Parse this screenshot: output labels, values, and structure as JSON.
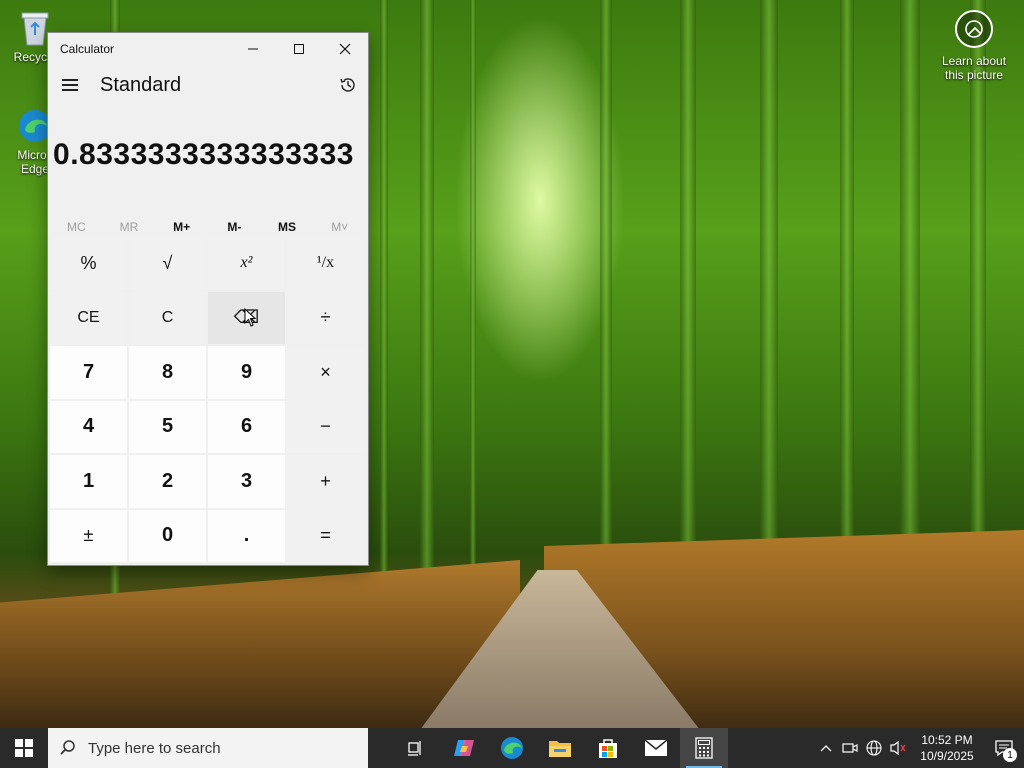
{
  "desktop": {
    "icons": [
      {
        "label": "Recycle",
        "icon": "recycle-bin-icon"
      },
      {
        "label": "Micros Edge",
        "icon": "edge-icon"
      }
    ],
    "learn_label": "Learn about this picture"
  },
  "calculator": {
    "window_title": "Calculator",
    "mode": "Standard",
    "display_value": "0.8333333333333333",
    "memory_buttons": [
      "MC",
      "MR",
      "M+",
      "M-",
      "MS",
      "M˅"
    ],
    "keys": [
      "%",
      "√",
      "x²",
      "¹/x",
      "CE",
      "C",
      "⌫",
      "÷",
      "7",
      "8",
      "9",
      "×",
      "4",
      "5",
      "6",
      "−",
      "1",
      "2",
      "3",
      "+",
      "±",
      "0",
      ".",
      "="
    ]
  },
  "taskbar": {
    "search_placeholder": "Type here to search",
    "clock_time": "10:52 PM",
    "clock_date": "10/9/2025",
    "notification_count": "1"
  },
  "colors": {
    "accent": "#76b9ed",
    "taskbar": "#2a2a2a",
    "calc_bg": "#f0f0f0"
  }
}
